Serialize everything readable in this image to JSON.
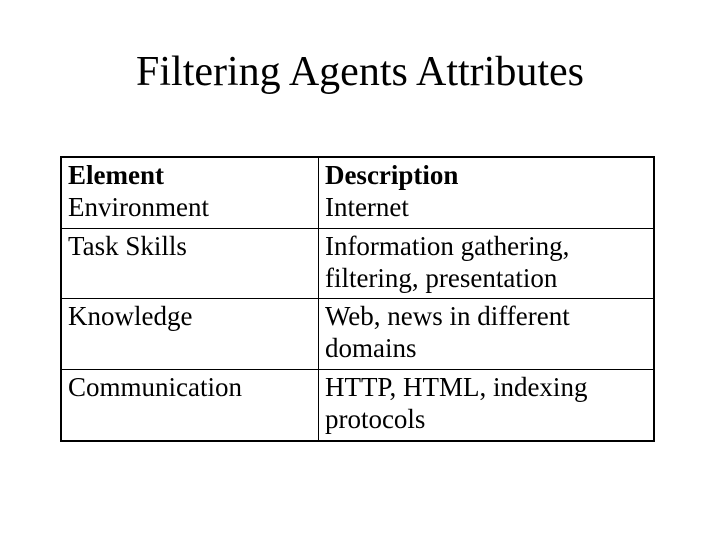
{
  "title": "Filtering Agents Attributes",
  "table": {
    "header": {
      "element": "Element",
      "description": "Description"
    },
    "rows": [
      {
        "element": "Environment",
        "description": "Internet"
      },
      {
        "element": "Task Skills",
        "description": "Information gathering, filtering, presentation"
      },
      {
        "element": "Knowledge",
        "description": "Web, news in different domains"
      },
      {
        "element": "Communication",
        "description": "HTTP, HTML, indexing protocols"
      }
    ]
  }
}
